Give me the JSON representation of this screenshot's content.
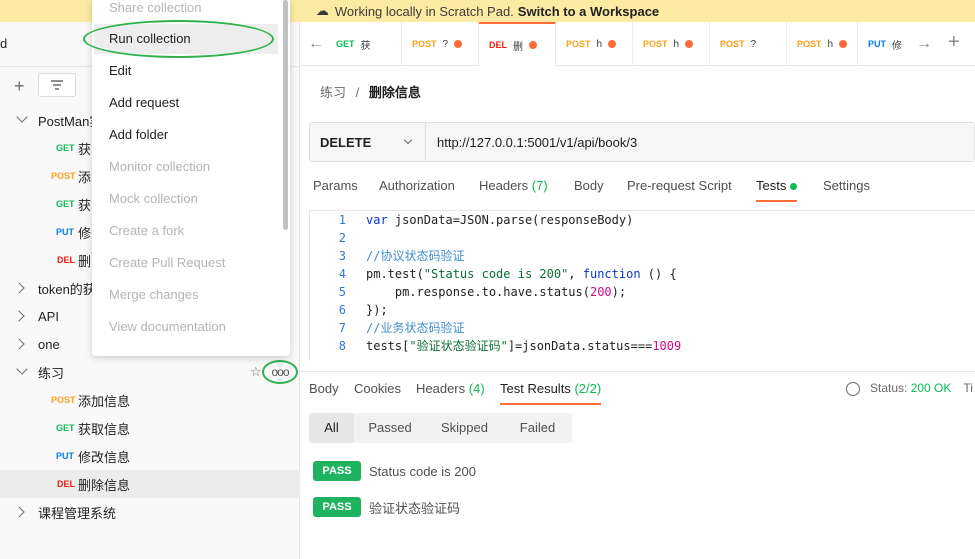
{
  "banner": {
    "text": "Working locally in Scratch Pad.",
    "link": "Switch to a Workspace",
    "icon": "cloud-off-icon"
  },
  "sidebar": {
    "top_label": "d",
    "tree": [
      {
        "type": "folder",
        "label": "PostMan实",
        "expanded": true
      },
      {
        "type": "req",
        "method": "GET",
        "label": "获"
      },
      {
        "type": "req",
        "method": "POST",
        "label": "添"
      },
      {
        "type": "req",
        "method": "GET",
        "label": "获"
      },
      {
        "type": "req",
        "method": "PUT",
        "label": "修"
      },
      {
        "type": "req",
        "method": "DEL",
        "label": "删"
      },
      {
        "type": "folder",
        "label": "token的获",
        "expanded": false
      },
      {
        "type": "folder",
        "label": "API",
        "expanded": false
      },
      {
        "type": "folder",
        "label": "one",
        "expanded": false
      },
      {
        "type": "folder",
        "label": "练习",
        "expanded": true
      },
      {
        "type": "req",
        "method": "POST",
        "label": "添加信息"
      },
      {
        "type": "req",
        "method": "GET",
        "label": "获取信息"
      },
      {
        "type": "req",
        "method": "PUT",
        "label": "修改信息"
      },
      {
        "type": "req",
        "method": "DEL",
        "label": "删除信息"
      },
      {
        "type": "folder",
        "label": "课程管理系统",
        "expanded": false
      }
    ],
    "more_label": "ooo"
  },
  "context_menu": {
    "items": [
      {
        "label": "Share collection",
        "disabled": true
      },
      {
        "label": "Run collection",
        "disabled": false
      },
      {
        "label": "Edit",
        "disabled": false
      },
      {
        "label": "Add request",
        "disabled": false
      },
      {
        "label": "Add folder",
        "disabled": false
      },
      {
        "label": "Monitor collection",
        "disabled": true
      },
      {
        "label": "Mock collection",
        "disabled": true
      },
      {
        "label": "Create a fork",
        "disabled": true
      },
      {
        "label": "Create Pull Request",
        "disabled": true
      },
      {
        "label": "Merge changes",
        "disabled": true
      },
      {
        "label": "View documentation",
        "disabled": true
      }
    ]
  },
  "tabs": [
    {
      "method": "GET",
      "name": "获",
      "dirty": false,
      "active": false
    },
    {
      "method": "POST",
      "name": "?",
      "dirty": true,
      "active": false
    },
    {
      "method": "DEL",
      "name": "删",
      "dirty": true,
      "active": true
    },
    {
      "method": "POST",
      "name": "h",
      "dirty": true,
      "active": false
    },
    {
      "method": "POST",
      "name": "h",
      "dirty": true,
      "active": false
    },
    {
      "method": "POST",
      "name": "?",
      "dirty": false,
      "active": false
    },
    {
      "method": "POST",
      "name": "h",
      "dirty": true,
      "active": false
    },
    {
      "method": "PUT",
      "name": "修",
      "dirty": false,
      "active": false
    }
  ],
  "breadcrumb": {
    "parent": "练习",
    "sep": "/",
    "current": "删除信息"
  },
  "request": {
    "method": "DELETE",
    "url": "http://127.0.0.1:5001/v1/api/book/3"
  },
  "request_tabs": [
    {
      "label": "Params"
    },
    {
      "label": "Authorization"
    },
    {
      "label": "Headers",
      "count": "(7)"
    },
    {
      "label": "Body"
    },
    {
      "label": "Pre-request Script"
    },
    {
      "label": "Tests",
      "active": true
    },
    {
      "label": "Settings"
    }
  ],
  "code_lines": [
    "var jsonData=JSON.parse(responseBody)",
    "",
    "//协议状态码验证",
    "pm.test(\"Status code is 200\", function () {",
    "    pm.response.to.have.status(200);",
    "});",
    "//业务状态码验证",
    "tests[\"验证状态验证码\"]=jsonData.status===1009"
  ],
  "response_tabs": [
    {
      "label": "Body"
    },
    {
      "label": "Cookies"
    },
    {
      "label": "Headers",
      "count": "(4)"
    },
    {
      "label": "Test Results",
      "count": "(2/2)",
      "active": true
    }
  ],
  "status": {
    "label": "Status:",
    "value": "200 OK",
    "trailing": "Ti"
  },
  "filters": [
    "All",
    "Passed",
    "Skipped",
    "Failed"
  ],
  "results": [
    {
      "badge": "PASS",
      "text": "Status code is 200"
    },
    {
      "badge": "PASS",
      "text": "验证状态验证码"
    }
  ]
}
